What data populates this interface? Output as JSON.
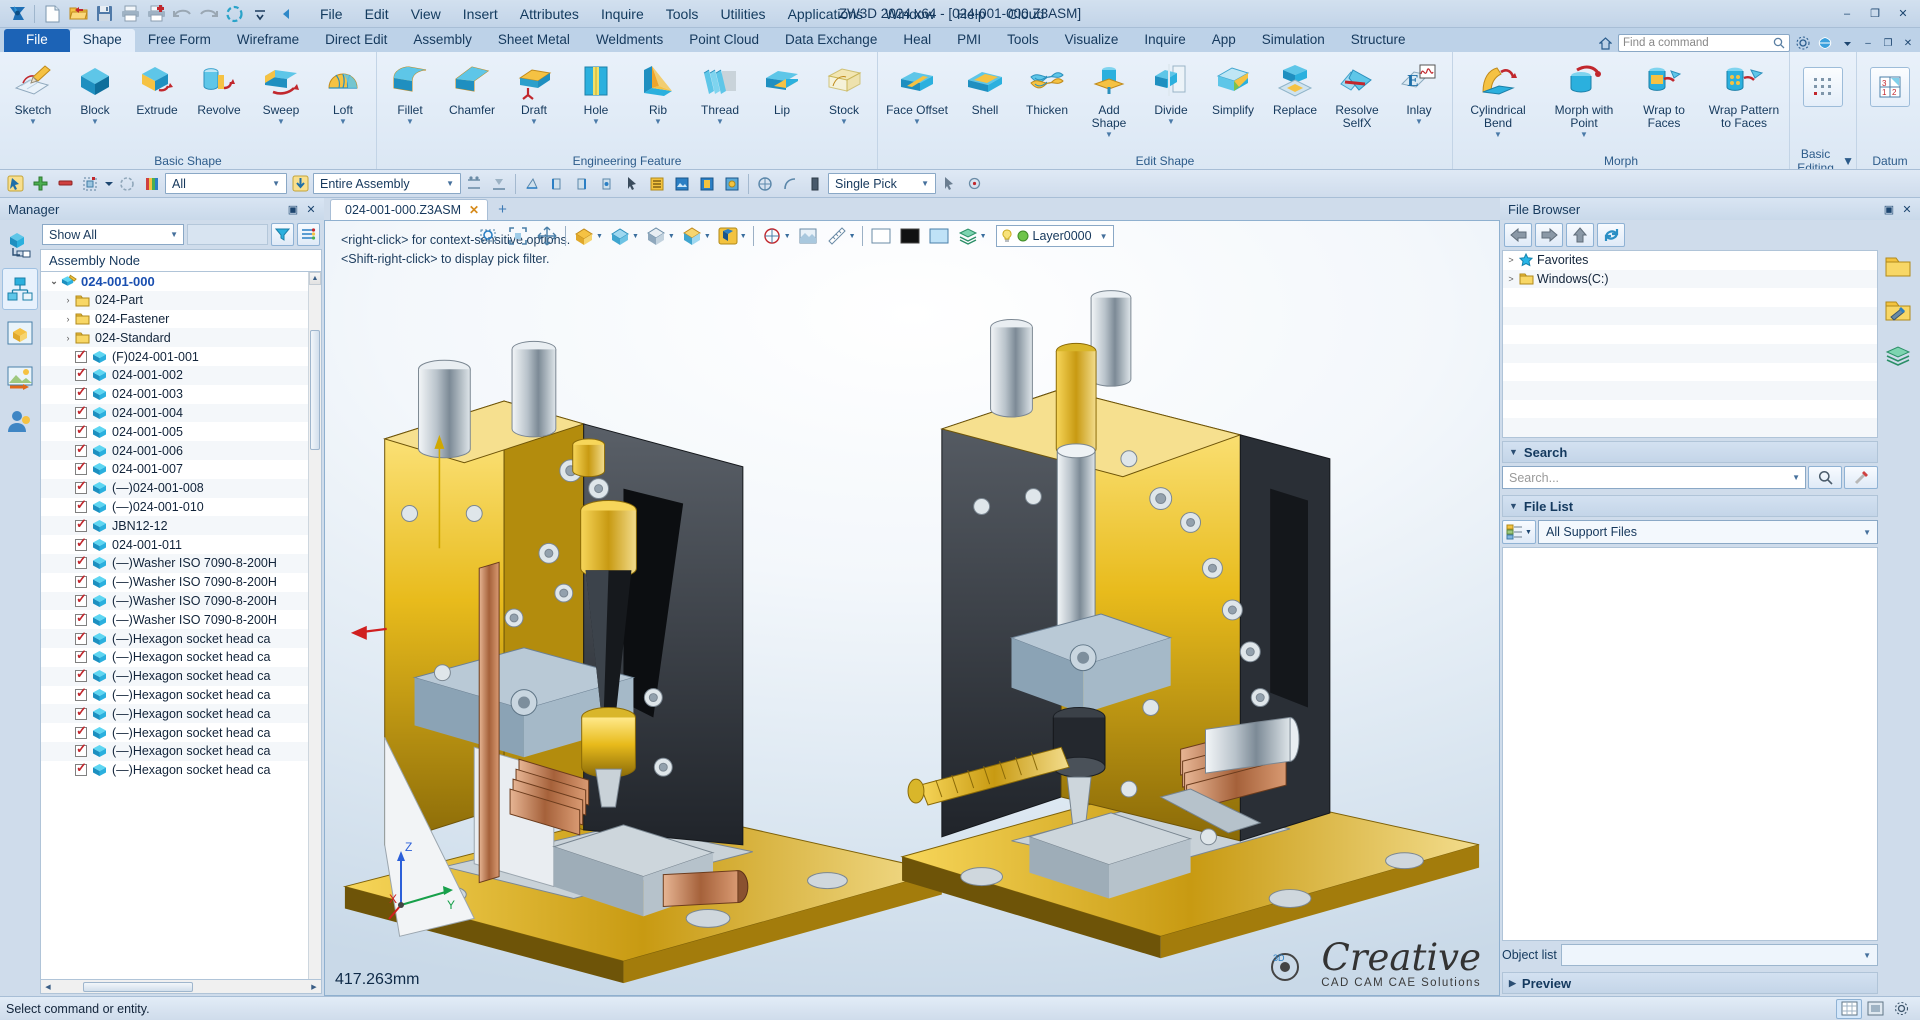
{
  "window": {
    "title": "ZW3D 2024 x64 - [024-001-000.Z3ASM]",
    "minimize": "–",
    "restore": "❐",
    "close": "✕"
  },
  "quick_access": [
    {
      "name": "zw3d-logo-icon",
      "glyph": "Z"
    },
    {
      "name": "new-file-icon",
      "glyph": "📄"
    },
    {
      "name": "open-file-icon",
      "glyph": "📂"
    },
    {
      "name": "save-icon",
      "glyph": "💾"
    },
    {
      "name": "print-icon",
      "glyph": "🖨"
    },
    {
      "name": "print-add-icon",
      "glyph": "🖨"
    },
    {
      "name": "undo-icon",
      "glyph": "↶"
    },
    {
      "name": "redo-icon",
      "glyph": "↷"
    },
    {
      "name": "regen-icon",
      "glyph": "◌"
    },
    {
      "name": "quick-access-dropdown-icon",
      "glyph": "▼"
    },
    {
      "name": "collapse-ribbon-icon",
      "glyph": "◀"
    }
  ],
  "menubar": [
    "File",
    "Edit",
    "View",
    "Insert",
    "Attributes",
    "Inquire",
    "Tools",
    "Utilities",
    "Applications",
    "Window",
    "Help",
    "Cloud"
  ],
  "ribbon_tabs": {
    "file_label": "File",
    "active": "Shape",
    "items": [
      "Shape",
      "Free Form",
      "Wireframe",
      "Direct Edit",
      "Assembly",
      "Sheet Metal",
      "Weldments",
      "Point Cloud",
      "Data Exchange",
      "Heal",
      "PMI",
      "Tools",
      "Visualize",
      "Inquire",
      "App",
      "Simulation",
      "Structure"
    ]
  },
  "command_search": {
    "placeholder": "Find a command",
    "icon": "search-icon"
  },
  "ribbon_right_icons": [
    {
      "name": "help-home-icon",
      "glyph": "⌂"
    },
    {
      "name": "settings-gear-icon",
      "glyph": "⚙"
    },
    {
      "name": "globe-icon",
      "glyph": "🌐"
    },
    {
      "name": "account-dropdown-icon",
      "glyph": "▾"
    }
  ],
  "ribbon_groups": [
    {
      "label": "Basic Shape",
      "buttons": [
        {
          "label": "Sketch",
          "icon": "sketch-icon",
          "caret": true
        },
        {
          "label": "Block",
          "icon": "block-icon",
          "caret": true
        },
        {
          "label": "Extrude",
          "icon": "extrude-icon",
          "caret": false
        },
        {
          "label": "Revolve",
          "icon": "revolve-icon",
          "caret": false
        },
        {
          "label": "Sweep",
          "icon": "sweep-icon",
          "caret": true
        },
        {
          "label": "Loft",
          "icon": "loft-icon",
          "caret": true
        }
      ]
    },
    {
      "label": "Engineering Feature",
      "buttons": [
        {
          "label": "Fillet",
          "icon": "fillet-icon",
          "caret": true
        },
        {
          "label": "Chamfer",
          "icon": "chamfer-icon",
          "caret": false
        },
        {
          "label": "Draft",
          "icon": "draft-icon",
          "caret": true
        },
        {
          "label": "Hole",
          "icon": "hole-icon",
          "caret": true
        },
        {
          "label": "Rib",
          "icon": "rib-icon",
          "caret": true
        },
        {
          "label": "Thread",
          "icon": "thread-icon",
          "caret": true
        },
        {
          "label": "Lip",
          "icon": "lip-icon",
          "caret": false
        },
        {
          "label": "Stock",
          "icon": "stock-icon",
          "caret": true
        }
      ]
    },
    {
      "label": "Edit Shape",
      "buttons": [
        {
          "label": "Face Offset",
          "icon": "face-offset-icon",
          "caret": true
        },
        {
          "label": "Shell",
          "icon": "shell-icon",
          "caret": false
        },
        {
          "label": "Thicken",
          "icon": "thicken-icon",
          "caret": false
        },
        {
          "label": "Add Shape",
          "icon": "add-shape-icon",
          "caret": true
        },
        {
          "label": "Divide",
          "icon": "divide-icon",
          "caret": true
        },
        {
          "label": "Simplify",
          "icon": "simplify-icon",
          "caret": false
        },
        {
          "label": "Replace",
          "icon": "replace-icon",
          "caret": false
        },
        {
          "label": "Resolve SelfX",
          "icon": "resolve-selfx-icon",
          "caret": false
        },
        {
          "label": "Inlay",
          "icon": "inlay-icon",
          "caret": true
        }
      ]
    },
    {
      "label": "Morph",
      "buttons": [
        {
          "label": "Cylindrical Bend",
          "icon": "cylindrical-bend-icon",
          "caret": true
        },
        {
          "label": "Morph with Point",
          "icon": "morph-with-point-icon",
          "caret": true
        },
        {
          "label": "Wrap to Faces",
          "icon": "wrap-to-faces-icon",
          "caret": false
        },
        {
          "label": "Wrap Pattern to Faces",
          "icon": "wrap-pattern-to-faces-icon",
          "caret": false
        }
      ]
    }
  ],
  "ribbon_small_groups": [
    {
      "label": "Basic Editing",
      "icon": "basic-editing-icon",
      "caret": true
    },
    {
      "label": "Datum",
      "icon": "datum-icon",
      "caret": true
    }
  ],
  "toolbar2": {
    "filter_value": "All",
    "scope_value": "Entire Assembly",
    "pick_value": "Single Pick",
    "icons_left": [
      {
        "name": "select-entity-icon",
        "glyph": "⬈"
      },
      {
        "name": "add-selection-icon",
        "glyph": "✚"
      },
      {
        "name": "remove-selection-icon",
        "glyph": "▬"
      },
      {
        "name": "select-all-icon",
        "glyph": "⊞"
      },
      {
        "name": "select-all-dropdown-icon",
        "glyph": "▾"
      },
      {
        "name": "deselect-icon",
        "glyph": "◌"
      },
      {
        "name": "filter-color-icon",
        "glyph": "▥"
      }
    ],
    "icons_mid": [
      {
        "name": "align-top-icon",
        "glyph": "⎓"
      },
      {
        "name": "align-bottom-icon",
        "glyph": "⏛"
      },
      {
        "name": "pick-face-icon",
        "glyph": "◩"
      },
      {
        "name": "pick-edge-icon",
        "glyph": "◪"
      },
      {
        "name": "pick-curve-icon",
        "glyph": "◨"
      },
      {
        "name": "pick-point-icon",
        "glyph": "◧"
      },
      {
        "name": "pick-arrow-icon",
        "glyph": "➤"
      },
      {
        "name": "pick-list-icon",
        "glyph": "▤"
      },
      {
        "name": "pick-image-icon",
        "glyph": "▧"
      },
      {
        "name": "pick-block-icon",
        "glyph": "▣"
      },
      {
        "name": "pick-component-icon",
        "glyph": "▩"
      },
      {
        "name": "pick-circle-icon",
        "glyph": "◎"
      },
      {
        "name": "pick-curve2-icon",
        "glyph": "◠"
      },
      {
        "name": "pick-solid-icon",
        "glyph": "▮"
      }
    ],
    "icons_right": [
      {
        "name": "cursor-icon",
        "glyph": "➤"
      },
      {
        "name": "point-snap-icon",
        "glyph": "⊙"
      },
      {
        "name": "midpoint-snap-icon",
        "glyph": "⊗"
      },
      {
        "name": "center-snap-icon",
        "glyph": "⊕"
      },
      {
        "name": "quadrant-snap-icon",
        "glyph": "⊘"
      },
      {
        "name": "intersect-snap-icon",
        "glyph": "⊛"
      },
      {
        "name": "tangent-snap-icon",
        "glyph": "⊜"
      },
      {
        "name": "perp-snap-icon",
        "glyph": "⊥"
      },
      {
        "name": "nearest-snap-icon",
        "glyph": "⌖"
      },
      {
        "name": "snap-settings-icon",
        "glyph": "⚙"
      }
    ]
  },
  "manager": {
    "title": "Manager",
    "restore_icon": "▣",
    "close_icon": "✕",
    "filter_value": "Show All",
    "filter_button_icon": "funnel-icon",
    "options_button_icon": "tree-options-icon",
    "column_header": "Assembly Node",
    "vtabs": [
      {
        "name": "history-manager-tab",
        "icon": "history-icon",
        "active": false
      },
      {
        "name": "assembly-manager-tab",
        "icon": "assembly-tree-icon",
        "active": true
      },
      {
        "name": "part-manager-tab",
        "icon": "part-icon",
        "active": false
      },
      {
        "name": "visual-manager-tab",
        "icon": "visual-icon",
        "active": false
      },
      {
        "name": "user-manager-tab",
        "icon": "user-icon",
        "active": false
      }
    ],
    "tree": [
      {
        "label": "024-001-000",
        "type": "root",
        "expander": "v",
        "checkbox": false,
        "icon": "assembly-icon",
        "indent": 0
      },
      {
        "label": "024-Part",
        "type": "folder",
        "expander": ">",
        "checkbox": false,
        "icon": "folder-icon",
        "indent": 1
      },
      {
        "label": "024-Fastener",
        "type": "folder",
        "expander": ">",
        "checkbox": false,
        "icon": "folder-icon",
        "indent": 1
      },
      {
        "label": "024-Standard",
        "type": "folder",
        "expander": ">",
        "checkbox": false,
        "icon": "folder-icon",
        "indent": 1
      },
      {
        "label": "(F)024-001-001",
        "type": "part",
        "expander": "",
        "checkbox": true,
        "icon": "component-icon",
        "indent": 1
      },
      {
        "label": "024-001-002",
        "type": "part",
        "expander": "",
        "checkbox": true,
        "icon": "component-icon",
        "indent": 1
      },
      {
        "label": "024-001-003",
        "type": "part",
        "expander": "",
        "checkbox": true,
        "icon": "component-icon",
        "indent": 1
      },
      {
        "label": "024-001-004",
        "type": "part",
        "expander": "",
        "checkbox": true,
        "icon": "component-icon",
        "indent": 1
      },
      {
        "label": "024-001-005",
        "type": "part",
        "expander": "",
        "checkbox": true,
        "icon": "component-icon",
        "indent": 1
      },
      {
        "label": "024-001-006",
        "type": "part",
        "expander": "",
        "checkbox": true,
        "icon": "component-icon",
        "indent": 1
      },
      {
        "label": "024-001-007",
        "type": "part",
        "expander": "",
        "checkbox": true,
        "icon": "component-icon",
        "indent": 1
      },
      {
        "label": "(—)024-001-008",
        "type": "part",
        "expander": "",
        "checkbox": true,
        "icon": "component-icon",
        "indent": 1
      },
      {
        "label": "(—)024-001-010",
        "type": "part",
        "expander": "",
        "checkbox": true,
        "icon": "component-icon",
        "indent": 1
      },
      {
        "label": "JBN12-12",
        "type": "part",
        "expander": "",
        "checkbox": true,
        "icon": "component-icon",
        "indent": 1
      },
      {
        "label": "024-001-011",
        "type": "part",
        "expander": "",
        "checkbox": true,
        "icon": "component-icon",
        "indent": 1
      },
      {
        "label": "(—)Washer ISO 7090-8-200H",
        "type": "part",
        "expander": "",
        "checkbox": true,
        "icon": "component-icon",
        "indent": 1
      },
      {
        "label": "(—)Washer ISO 7090-8-200H",
        "type": "part",
        "expander": "",
        "checkbox": true,
        "icon": "component-icon",
        "indent": 1
      },
      {
        "label": "(—)Washer ISO 7090-8-200H",
        "type": "part",
        "expander": "",
        "checkbox": true,
        "icon": "component-icon",
        "indent": 1
      },
      {
        "label": "(—)Washer ISO 7090-8-200H",
        "type": "part",
        "expander": "",
        "checkbox": true,
        "icon": "component-icon",
        "indent": 1
      },
      {
        "label": "(—)Hexagon socket head ca",
        "type": "part",
        "expander": "",
        "checkbox": true,
        "icon": "component-icon",
        "indent": 1
      },
      {
        "label": "(—)Hexagon socket head ca",
        "type": "part",
        "expander": "",
        "checkbox": true,
        "icon": "component-icon",
        "indent": 1
      },
      {
        "label": "(—)Hexagon socket head ca",
        "type": "part",
        "expander": "",
        "checkbox": true,
        "icon": "component-icon",
        "indent": 1
      },
      {
        "label": "(—)Hexagon socket head ca",
        "type": "part",
        "expander": "",
        "checkbox": true,
        "icon": "component-icon",
        "indent": 1
      },
      {
        "label": "(—)Hexagon socket head ca",
        "type": "part",
        "expander": "",
        "checkbox": true,
        "icon": "component-icon",
        "indent": 1
      },
      {
        "label": "(—)Hexagon socket head ca",
        "type": "part",
        "expander": "",
        "checkbox": true,
        "icon": "component-icon",
        "indent": 1
      },
      {
        "label": "(—)Hexagon socket head ca",
        "type": "part",
        "expander": "",
        "checkbox": true,
        "icon": "component-icon",
        "indent": 1
      },
      {
        "label": "(—)Hexagon socket head ca",
        "type": "part",
        "expander": "",
        "checkbox": true,
        "icon": "component-icon",
        "indent": 1
      }
    ]
  },
  "document": {
    "tab_label": "024-001-000.Z3ASM",
    "tab_close": "✕",
    "new_tab": "+"
  },
  "viewport": {
    "hint_line1": "<right-click> for context-sensitive options.",
    "hint_line2": "<Shift-right-click> to display pick filter.",
    "dimension_readout": "417.263mm",
    "layer_value": "Layer0000",
    "watermark_title": "Creative",
    "watermark_subtitle": "CAD CAM CAE Solutions",
    "axis_labels": [
      "X",
      "Y",
      "Z"
    ],
    "toolbar_icons": [
      {
        "name": "zoom-window-icon",
        "glyph": "⬚"
      },
      {
        "name": "zoom-all-icon",
        "glyph": "⛶"
      },
      {
        "name": "pan-icon",
        "glyph": "✥"
      },
      {
        "name": "rotate-view-icon",
        "glyph": "⟳"
      },
      {
        "name": "standard-views-icon",
        "glyph": "◳"
      },
      {
        "name": "isometric-view-icon",
        "glyph": "◰"
      },
      {
        "name": "shading-mode-icon",
        "glyph": "◑"
      },
      {
        "name": "render-mode-icon",
        "glyph": "◉"
      },
      {
        "name": "section-view-icon",
        "glyph": "◧"
      },
      {
        "name": "visibility-icon",
        "glyph": "◎"
      },
      {
        "name": "background-icon",
        "glyph": "▦"
      },
      {
        "name": "color-swatch-black-icon",
        "glyph": ""
      },
      {
        "name": "color-swatch-blue-icon",
        "glyph": ""
      },
      {
        "name": "layer-stack-icon",
        "glyph": "◈"
      }
    ],
    "layer_bulb_icon": "lightbulb-icon"
  },
  "file_browser": {
    "title": "File Browser",
    "restore_icon": "▣",
    "close_icon": "✕",
    "nav": [
      {
        "name": "nav-back-button",
        "glyph": "⬅"
      },
      {
        "name": "nav-forward-button",
        "glyph": "➡"
      },
      {
        "name": "nav-up-button",
        "glyph": "⬆"
      },
      {
        "name": "nav-refresh-button",
        "glyph": "⟳"
      }
    ],
    "tree": [
      {
        "label": "Favorites",
        "expander": ">",
        "icon": "star-icon"
      },
      {
        "label": "Windows(C:)",
        "expander": ">",
        "icon": "folder-icon"
      }
    ],
    "search_section": "Search",
    "search_placeholder": "Search...",
    "search_button_icon": "search-icon",
    "search_clear_icon": "clear-icon",
    "file_list_section": "File List",
    "filter_value": "All Support Files",
    "filter_type_icon": "file-type-icon",
    "object_list_label": "Object list",
    "object_list_value": "",
    "preview_section": "Preview",
    "vtabs": [
      {
        "name": "folder-browser-tab",
        "icon": "folder-icon"
      },
      {
        "name": "recent-files-tab",
        "icon": "folder-link-icon"
      },
      {
        "name": "layers-tab",
        "icon": "stack-icon"
      }
    ]
  },
  "statusbar": {
    "message": "Select command or entity.",
    "icons": [
      {
        "name": "grid-toggle-icon",
        "glyph": "▦",
        "active": true
      },
      {
        "name": "snap-toggle-icon",
        "glyph": "▣",
        "active": false
      },
      {
        "name": "config-icon",
        "glyph": "⚙",
        "active": false
      }
    ]
  },
  "colors": {
    "accent_blue": "#1c63b6",
    "ribbon_bg": "#e4eefa",
    "title_bg": "#c2d4e8",
    "tree_highlight": "#1a4fb0",
    "check_red": "#c1272d",
    "folder_yellow": "#f3b940",
    "component_cyan": "#29a8d8"
  }
}
